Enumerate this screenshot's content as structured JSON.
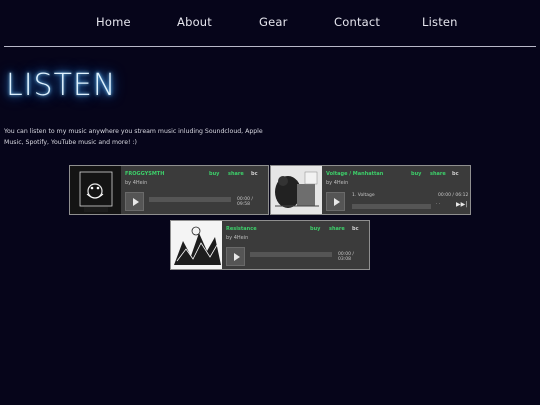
{
  "nav": {
    "items": [
      {
        "label": "Home"
      },
      {
        "label": "About"
      },
      {
        "label": "Gear"
      },
      {
        "label": "Contact"
      },
      {
        "label": "Listen"
      }
    ]
  },
  "page": {
    "heading": "LISTEN",
    "intro": "You can listen to my music anywhere you stream music inluding Soundcloud, Apple Music, Spotify, YouTube music and more! :)"
  },
  "players": [
    {
      "title": "FROGGYSMTH",
      "artist": "by 4Hein",
      "buy": "buy",
      "share": "share",
      "brand": "bc",
      "time": "00:00 / 09:58",
      "track_label": ""
    },
    {
      "title": "Voltage / Manhattan",
      "artist": "by 4Hein",
      "buy": "buy",
      "share": "share",
      "brand": "bc",
      "time": "00:00 / 06:12",
      "track_label": "1.  Voltage"
    },
    {
      "title": "Resistance",
      "artist": "by 4Hein",
      "buy": "buy",
      "share": "share",
      "brand": "bc",
      "time": "00:00 / 03:08",
      "track_label": ""
    }
  ],
  "colors": {
    "background": "#06051a",
    "accent_green": "#3dcf6a",
    "neon_blue": "#3aa6ff"
  },
  "icons": {
    "play": "play-icon",
    "next": "next-track-icon"
  }
}
